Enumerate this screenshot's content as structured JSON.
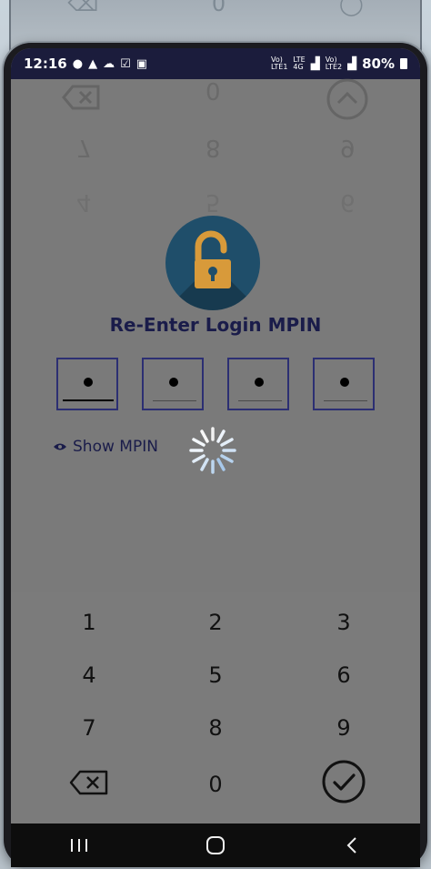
{
  "status_bar": {
    "time": "12:16",
    "net1_top": "Vo)",
    "net1_bottom": "LTE1",
    "net2_top": "LTE",
    "net2_bottom": "4G",
    "net3_top": "Vo)",
    "net3_bottom": "LTE2",
    "battery": "80%"
  },
  "title": "Re-Enter Login MPIN",
  "pin": {
    "entered_count": 4,
    "masked_char": "•"
  },
  "show_mpin_label": "Show MPIN",
  "keypad": {
    "keys": [
      "1",
      "2",
      "3",
      "4",
      "5",
      "6",
      "7",
      "8",
      "9"
    ],
    "zero": "0"
  },
  "ghost_keypad": {
    "row1": [
      "0"
    ],
    "row2": [
      "7",
      "8",
      "9"
    ],
    "row3": [
      "4",
      "5",
      "6"
    ]
  },
  "colors": {
    "accent": "#2c2f73",
    "title": "#1a1c4a",
    "lock_bg": "#1f4e6a",
    "lock_gold": "#d89a3a",
    "status_bar": "#1b1c3c",
    "overlay": "#7a7a7a"
  },
  "icons": {
    "backspace": "backspace-icon",
    "confirm": "check-circle-icon",
    "unlock": "unlock-icon",
    "eye": "eye-icon",
    "spinner": "loading-spinner-icon"
  }
}
